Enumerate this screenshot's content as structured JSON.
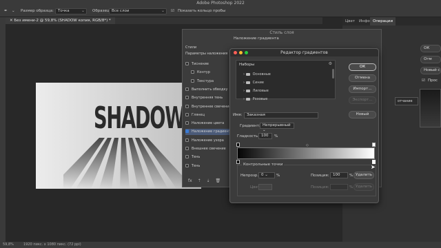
{
  "window": {
    "title": "Adobe Photoshop 2022"
  },
  "options_bar": {
    "sample_size_label": "Размер образца:",
    "sample_size_value": "Точка",
    "sample_label": "Образец:",
    "sample_value": "Все слои",
    "show_ring_label": "Показать кольцо пробы"
  },
  "document_tab": {
    "label": "Без имени-2 @ 59,8% (SHADOW копия, RGB/8*) *"
  },
  "canvas": {
    "text": "SHADOW"
  },
  "status_bar": {
    "zoom": "59,8%",
    "size": "1920 пикс. x 1080 пикс. (72 ppi)"
  },
  "right_panel": {
    "tabs": [
      "Цвет",
      "Инфо",
      "Операции"
    ],
    "active_tab": "Операции",
    "buttons": [
      "ОК",
      "Отм",
      "Новый с",
      "Прос"
    ],
    "partial_text": "отчание"
  },
  "layer_style": {
    "title": "Стиль слоя",
    "section_title": "Наложение градиента",
    "header_styles": "Стили",
    "header_blend": "Параметры наложения",
    "items": [
      {
        "label": "Тиснение",
        "checked": false,
        "indent": false
      },
      {
        "label": "Контур",
        "checked": false,
        "indent": true
      },
      {
        "label": "Текстура",
        "checked": false,
        "indent": true
      },
      {
        "label": "Выполнить обводку",
        "checked": false,
        "indent": false
      },
      {
        "label": "Внутренняя тень",
        "checked": false,
        "indent": false
      },
      {
        "label": "Внутреннее свечение",
        "checked": false,
        "indent": false
      },
      {
        "label": "Глянец",
        "checked": false,
        "indent": false
      },
      {
        "label": "Наложение цвета",
        "checked": false,
        "indent": false
      },
      {
        "label": "Наложение градиента",
        "checked": true,
        "indent": false
      },
      {
        "label": "Наложение узора",
        "checked": false,
        "indent": false
      },
      {
        "label": "Внешнее свечение",
        "checked": false,
        "indent": false
      },
      {
        "label": "Тень",
        "checked": false,
        "indent": false
      },
      {
        "label": "Тень",
        "checked": false,
        "indent": false
      }
    ],
    "footer_icons": [
      "fx-icon",
      "arrow-up-icon",
      "arrow-down-icon",
      "trash-icon"
    ]
  },
  "gradient_editor": {
    "title": "Редактор градиентов",
    "presets_label": "Наборы",
    "preset_folders": [
      "Основные",
      "Синие",
      "Лиловые",
      "Розовые"
    ],
    "buttons": {
      "ok": "ОК",
      "cancel": "Отмена",
      "import": "Импорт...",
      "export": "Экспорт...",
      "new": "Новый"
    },
    "name_label": "Имя:",
    "name_value": "Заказная",
    "gradient_type_label": "Градиент:",
    "gradient_type_value": "Непрерывный",
    "smoothness_label": "Гладкость:",
    "smoothness_value": "100",
    "smoothness_unit": "%",
    "control_points": {
      "title": "Контрольные точки",
      "opacity_label": "Непрозр.:",
      "opacity_value": "0",
      "opacity_unit": "%",
      "position_label": "Позиция:",
      "position_value": "100",
      "position_unit": "%",
      "delete_label": "Удалить",
      "color_label": "Цвет",
      "position2_label": "Позиция:",
      "position2_unit": "%",
      "delete2_label": "Удалить"
    }
  },
  "colors": {
    "accent": "#3a7bd5",
    "dialog_bg": "#3b3b3b"
  }
}
